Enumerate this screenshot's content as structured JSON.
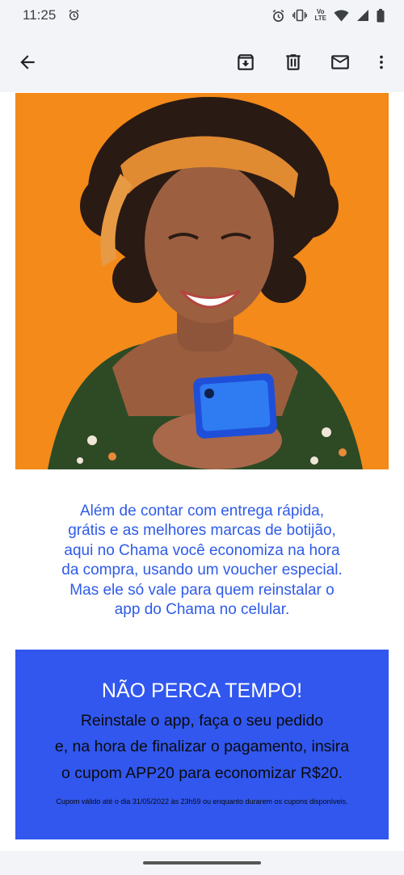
{
  "status_bar": {
    "time": "11:25",
    "icons": [
      "alarm-icon",
      "alarm-icon",
      "vibrate-icon",
      "volte-icon",
      "wifi-icon",
      "signal-icon",
      "battery-icon"
    ],
    "volte_top": "Vo",
    "volte_bottom": "LTE"
  },
  "app_bar": {
    "icons": [
      "back-arrow-icon",
      "archive-icon",
      "delete-icon",
      "mark-unread-icon",
      "more-vert-icon"
    ]
  },
  "hero": {
    "background_color": "#f38a1a"
  },
  "body_text": {
    "line1": "Além de contar com entrega rápida,",
    "line2": "grátis e as melhores marcas de botijão,",
    "line3": "aqui no Chama você economiza na hora",
    "line4": "da compra, usando um voucher especial.",
    "line5": "Mas ele só vale para quem reinstalar o",
    "line6": "app do Chama no celular.",
    "color": "#2f5be8"
  },
  "promo": {
    "title": "NÃO PERCA TEMPO!",
    "line1": "Reinstale o app, faça o seu pedido",
    "line2": "e, na hora de finalizar o pagamento, insira",
    "line3": "o cupom APP20 para economizar R$20.",
    "note": "Cupom válido até o dia 31/05/2022 às 23h59 ou enquanto durarem os cupons disponíveis.",
    "background_color": "#3157ef"
  }
}
